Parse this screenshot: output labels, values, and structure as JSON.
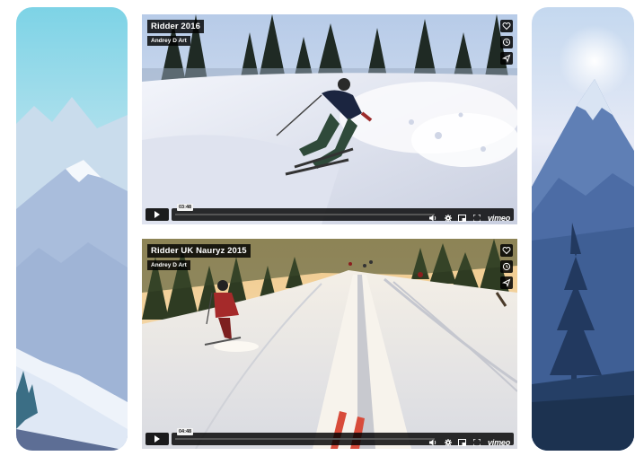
{
  "videos": [
    {
      "title": "Ridder 2016",
      "author": "Andrey D Art",
      "time": "03:48"
    },
    {
      "title": "Ridder UK Nauryz 2015",
      "author": "Andrey D Art",
      "time": "04:48"
    }
  ],
  "player": {
    "brand": "vimeo",
    "actions": [
      "heart-icon",
      "clock-icon",
      "send-icon"
    ],
    "controls": [
      "play-icon",
      "volume-icon",
      "settings-icon",
      "pip-icon",
      "fullscreen-icon"
    ]
  }
}
